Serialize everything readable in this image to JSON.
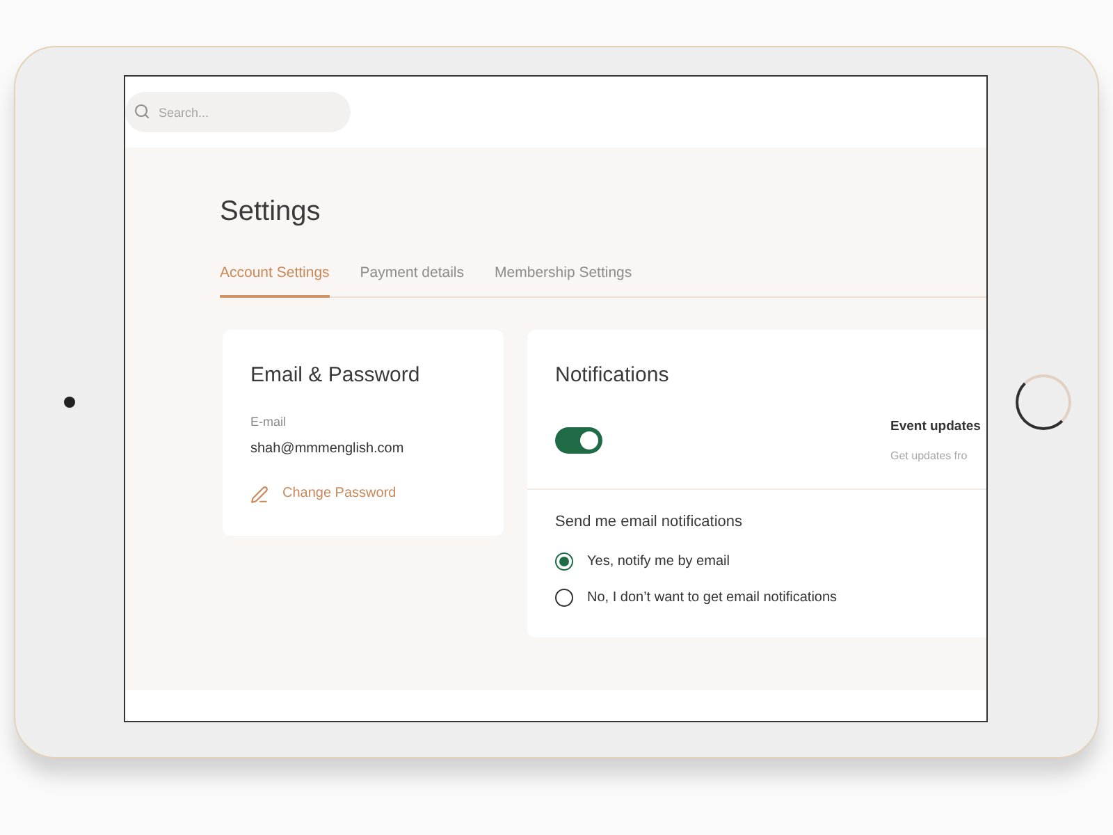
{
  "search": {
    "placeholder": "Search..."
  },
  "page_title": "Settings",
  "tabs": [
    {
      "label": "Account Settings",
      "selected": true
    },
    {
      "label": "Payment details",
      "selected": false
    },
    {
      "label": "Membership Settings",
      "selected": false
    }
  ],
  "email_card": {
    "title": "Email & Password",
    "email_label": "E-mail",
    "email": "shah@mmmenglish.com",
    "change_password": "Change Password"
  },
  "notifications_card": {
    "title": "Notifications",
    "toggle": {
      "on": true
    },
    "event_updates": {
      "title": "Event updates",
      "description": "Get updates fro"
    },
    "email_question": "Send me email notifications",
    "options": [
      {
        "label": "Yes, notify me by email",
        "selected": true
      },
      {
        "label": "No, I don’t want to get email notifications",
        "selected": false
      }
    ]
  }
}
